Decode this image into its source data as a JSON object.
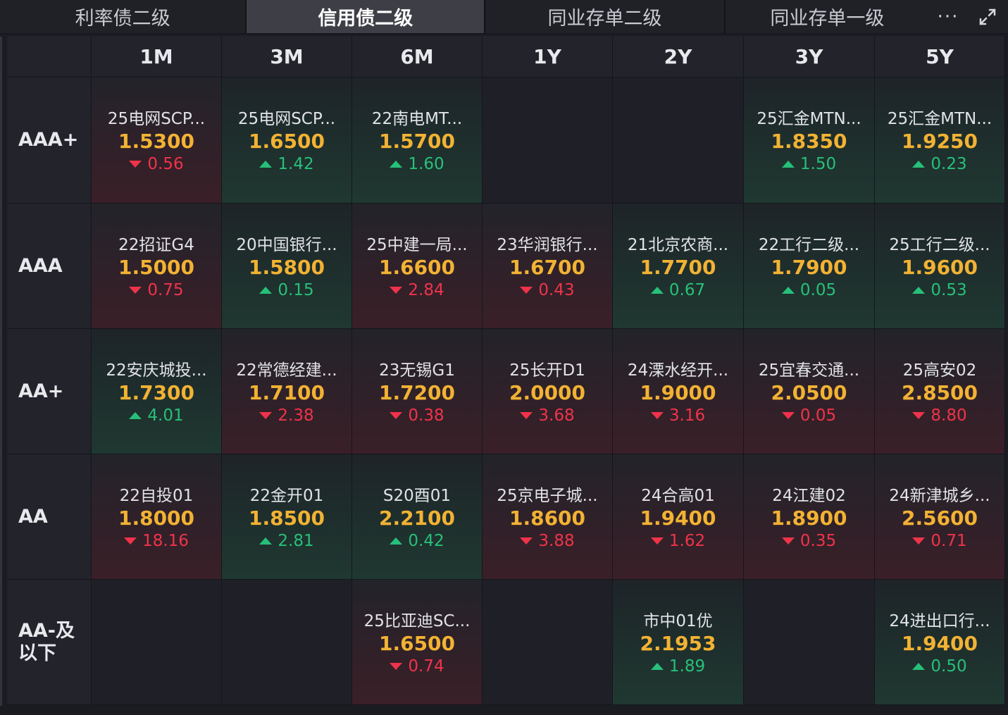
{
  "tabs": [
    {
      "label": "利率债二级",
      "active": false
    },
    {
      "label": "信用债二级",
      "active": true
    },
    {
      "label": "同业存单二级",
      "active": false
    },
    {
      "label": "同业存单一级",
      "active": false
    }
  ],
  "toolbar": {
    "more_icon": "more-icon",
    "expand_icon": "expand-icon",
    "more_glyph": "···"
  },
  "colors": {
    "up": "#27c07a",
    "down": "#f0334a",
    "yield": "#f2b233",
    "active_tab": "#3e3f46"
  },
  "columns": [
    "1M",
    "3M",
    "6M",
    "1Y",
    "2Y",
    "3Y",
    "5Y"
  ],
  "rows": [
    {
      "label": "AAA+",
      "cells": [
        {
          "name": "25电网SCP...",
          "yield": "1.5300",
          "change": "0.56",
          "dir": "down"
        },
        {
          "name": "25电网SCP...",
          "yield": "1.6500",
          "change": "1.42",
          "dir": "up"
        },
        {
          "name": "22南电MT...",
          "yield": "1.5700",
          "change": "1.60",
          "dir": "up"
        },
        null,
        null,
        {
          "name": "25汇金MTN...",
          "yield": "1.8350",
          "change": "1.50",
          "dir": "up"
        },
        {
          "name": "25汇金MTN...",
          "yield": "1.9250",
          "change": "0.23",
          "dir": "up"
        }
      ]
    },
    {
      "label": "AAA",
      "cells": [
        {
          "name": "22招证G4",
          "yield": "1.5000",
          "change": "0.75",
          "dir": "down"
        },
        {
          "name": "20中国银行...",
          "yield": "1.5800",
          "change": "0.15",
          "dir": "up"
        },
        {
          "name": "25中建一局...",
          "yield": "1.6600",
          "change": "2.84",
          "dir": "down"
        },
        {
          "name": "23华润银行...",
          "yield": "1.6700",
          "change": "0.43",
          "dir": "down"
        },
        {
          "name": "21北京农商...",
          "yield": "1.7700",
          "change": "0.67",
          "dir": "up"
        },
        {
          "name": "22工行二级...",
          "yield": "1.7900",
          "change": "0.05",
          "dir": "up"
        },
        {
          "name": "25工行二级...",
          "yield": "1.9600",
          "change": "0.53",
          "dir": "up"
        }
      ]
    },
    {
      "label": "AA+",
      "cells": [
        {
          "name": "22安庆城投...",
          "yield": "1.7300",
          "change": "4.01",
          "dir": "up"
        },
        {
          "name": "22常德经建...",
          "yield": "1.7100",
          "change": "2.38",
          "dir": "down"
        },
        {
          "name": "23无锡G1",
          "yield": "1.7200",
          "change": "0.38",
          "dir": "down"
        },
        {
          "name": "25长开D1",
          "yield": "2.0000",
          "change": "3.68",
          "dir": "down"
        },
        {
          "name": "24溧水经开...",
          "yield": "1.9000",
          "change": "3.16",
          "dir": "down"
        },
        {
          "name": "25宜春交通...",
          "yield": "2.0500",
          "change": "0.05",
          "dir": "down"
        },
        {
          "name": "25高安02",
          "yield": "2.8500",
          "change": "8.80",
          "dir": "down"
        }
      ]
    },
    {
      "label": "AA",
      "cells": [
        {
          "name": "22自投01",
          "yield": "1.8000",
          "change": "18.16",
          "dir": "down"
        },
        {
          "name": "22金开01",
          "yield": "1.8500",
          "change": "2.81",
          "dir": "up"
        },
        {
          "name": "S20酉01",
          "yield": "2.2100",
          "change": "0.42",
          "dir": "up"
        },
        {
          "name": "25京电子城...",
          "yield": "1.8600",
          "change": "3.88",
          "dir": "down"
        },
        {
          "name": "24合高01",
          "yield": "1.9400",
          "change": "1.62",
          "dir": "down"
        },
        {
          "name": "24江建02",
          "yield": "1.8900",
          "change": "0.35",
          "dir": "down"
        },
        {
          "name": "24新津城乡...",
          "yield": "2.5600",
          "change": "0.71",
          "dir": "down"
        }
      ]
    },
    {
      "label": "AA-及以下",
      "cells": [
        null,
        null,
        {
          "name": "25比亚迪SC...",
          "yield": "1.6500",
          "change": "0.74",
          "dir": "down"
        },
        null,
        {
          "name": "市中01优",
          "yield": "2.1953",
          "change": "1.89",
          "dir": "up"
        },
        null,
        {
          "name": "24进出口行...",
          "yield": "1.9400",
          "change": "0.50",
          "dir": "up"
        }
      ]
    }
  ]
}
